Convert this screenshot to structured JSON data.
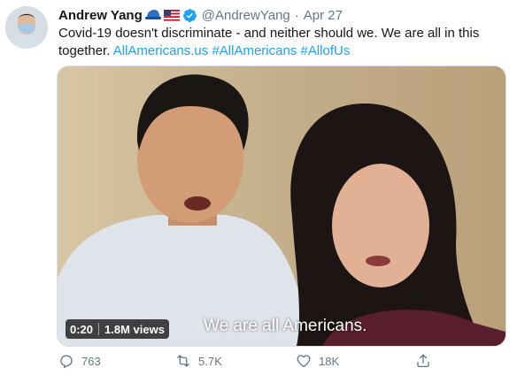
{
  "tweet": {
    "author_name": "Andrew Yang",
    "emoji_icons": [
      "blue-cap-icon",
      "us-flag-icon"
    ],
    "verified_icon": "verified-badge-icon",
    "handle": "@AndrewYang",
    "separator": "·",
    "date": "Apr 27",
    "text_plain": "Covid-19 doesn't discriminate - and neither should we. We are all in this together.",
    "links": [
      "AllAmericans.us",
      "#AllAmericans",
      "#AllofUs"
    ]
  },
  "video": {
    "duration": "0:20",
    "views": "1.8M views",
    "caption": "We are all Americans."
  },
  "actions": {
    "reply_count": "763",
    "retweet_count": "5.7K",
    "like_count": "18K"
  },
  "colors": {
    "link": "#1da1f2",
    "secondary_text": "#657786",
    "verified": "#1da1f2"
  }
}
